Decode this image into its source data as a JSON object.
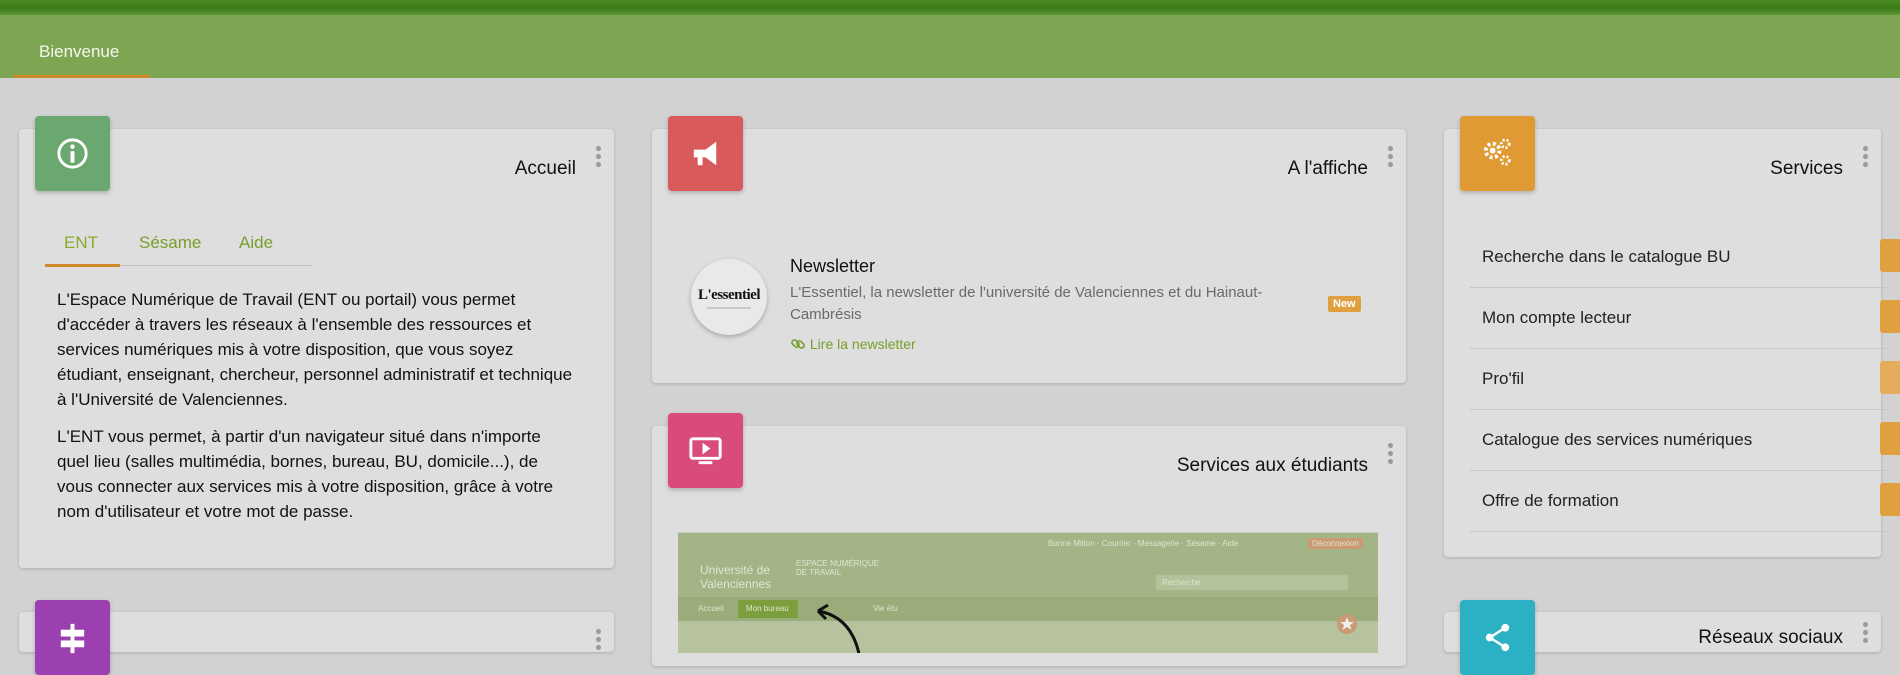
{
  "nav": {
    "tab_label": "Bienvenue"
  },
  "colors": {
    "header_bg": "#7da552",
    "accent_underline": "#d08a2a",
    "link_green": "#7a9e2c",
    "badge_green": "#6aa86f",
    "badge_red": "#d85a5a",
    "badge_orange": "#e09a34",
    "badge_pink": "#d94b78",
    "badge_purple": "#9c3fb0",
    "badge_teal": "#2bb0c4"
  },
  "accueil": {
    "title": "Accueil",
    "tabs": [
      "ENT",
      "Sésame",
      "Aide"
    ],
    "paragraph1": "L'Espace Numérique de Travail (ENT ou portail) vous permet d'accéder à travers les réseaux à l'ensemble des ressources et services numériques mis à votre disposition, que vous soyez étudiant, enseignant, chercheur, personnel administratif et technique à l'Université de Valenciennes.",
    "paragraph2": "L'ENT vous permet, à partir d'un navigateur situé dans n'importe quel lieu (salles multimédia, bornes, bureau, BU, domicile...), de vous connecter aux services mis à votre disposition, grâce à votre nom d'utilisateur et votre mot de passe."
  },
  "affiche": {
    "title": "A l'affiche",
    "item": {
      "logo_text": "L'essentiel",
      "title": "Newsletter",
      "description": "L'Essentiel, la newsletter de l'université de Valenciennes et du Hainaut-Cambrésis",
      "link": "Lire la newsletter",
      "badge": "New"
    }
  },
  "etudiants": {
    "title": "Services aux étudiants",
    "preview": {
      "university": "Université de Valenciennes",
      "portal": "ESPACE NUMÉRIQUE DE TRAVAIL",
      "search": "Recherche",
      "tabs": [
        "Accueil",
        "Mon bureau",
        "Vie étu"
      ],
      "userbar": "Bonne Milton · Courrier · Messagerie · Sésame · Aide",
      "logout": "Déconnexion"
    }
  },
  "services": {
    "title": "Services",
    "items": [
      {
        "label": "Recherche dans le catalogue BU",
        "icon": "search-icon"
      },
      {
        "label": "Mon compte lecteur",
        "icon": "book-icon"
      },
      {
        "label": "Pro'fil",
        "icon": "profil-logo-icon"
      },
      {
        "label": "Catalogue des services numériques",
        "icon": "lightbulb-icon"
      },
      {
        "label": "Offre de formation",
        "icon": "graduation-cap-icon"
      }
    ]
  },
  "reseaux": {
    "title": "Réseaux sociaux"
  }
}
